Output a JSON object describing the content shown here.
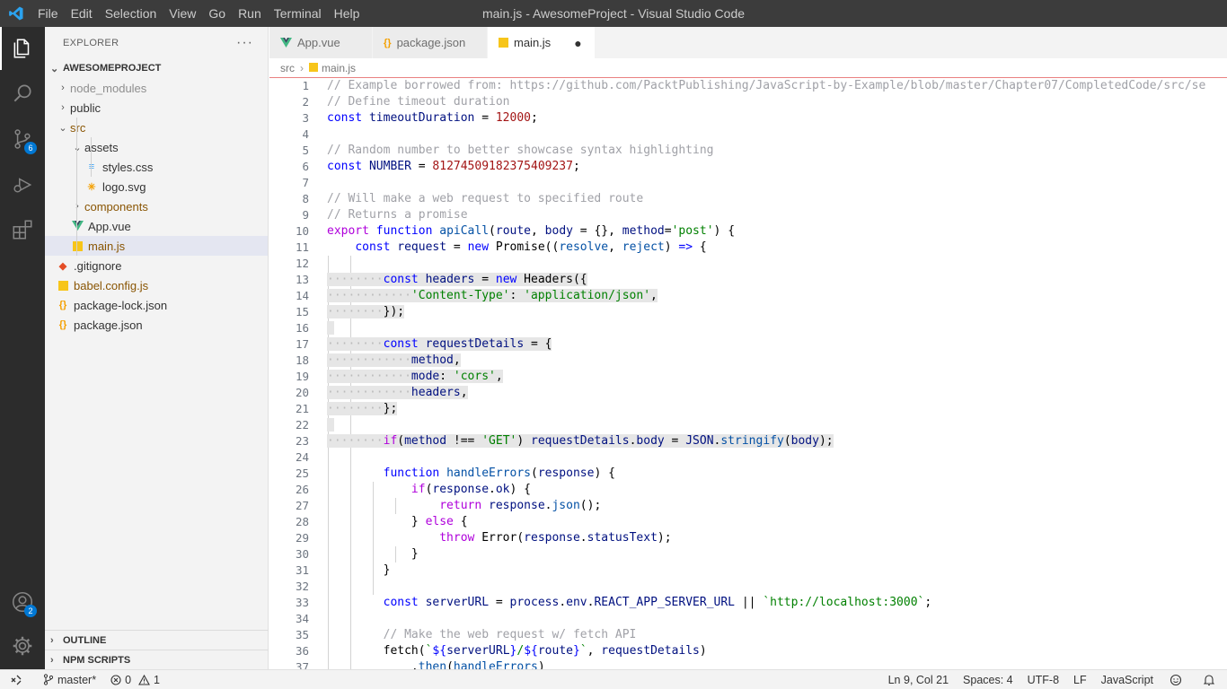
{
  "window": {
    "title": "main.js - AwesomeProject - Visual Studio Code"
  },
  "menu": [
    "File",
    "Edit",
    "Selection",
    "View",
    "Go",
    "Run",
    "Terminal",
    "Help"
  ],
  "activity": {
    "scm_badge": "6",
    "accounts_badge": "2"
  },
  "sidebar": {
    "title": "EXPLORER",
    "more": "···",
    "project": "AWESOMEPROJECT",
    "tree": {
      "node_modules": "node_modules",
      "public": "public",
      "src": "src",
      "assets": "assets",
      "styles": "styles.css",
      "logo": "logo.svg",
      "components": "components",
      "app_vue": "App.vue",
      "main_js": "main.js",
      "gitignore": ".gitignore",
      "babel": "babel.config.js",
      "pkg_lock": "package-lock.json",
      "pkg": "package.json"
    },
    "outline": "OUTLINE",
    "npm": "NPM SCRIPTS"
  },
  "tabs": [
    {
      "label": "App.vue",
      "icon": "vue-icon"
    },
    {
      "label": "package.json",
      "icon": "json-icon"
    },
    {
      "label": "main.js",
      "icon": "js-icon",
      "dirty": "●"
    }
  ],
  "breadcrumb": {
    "folder": "src",
    "file": "main.js"
  },
  "code": {
    "line_numbers": [
      "1",
      "2",
      "3",
      "4",
      "5",
      "6",
      "7",
      "8",
      "9",
      "10",
      "11",
      "12",
      "13",
      "14",
      "15",
      "16",
      "17",
      "18",
      "19",
      "20",
      "21",
      "22",
      "23",
      "24",
      "25",
      "26",
      "27",
      "28",
      "29",
      "30",
      "31",
      "32",
      "33",
      "34",
      "35",
      "36",
      "37"
    ]
  },
  "status": {
    "branch": "master*",
    "errors": "0",
    "warnings": "1",
    "position": "Ln 9, Col 21",
    "spaces": "Spaces: 4",
    "encoding": "UTF-8",
    "eol": "LF",
    "language": "JavaScript"
  },
  "colors": {
    "accent": "#0078d4",
    "titlebar": "#3c3c3c",
    "activitybar": "#2c2c2c"
  }
}
